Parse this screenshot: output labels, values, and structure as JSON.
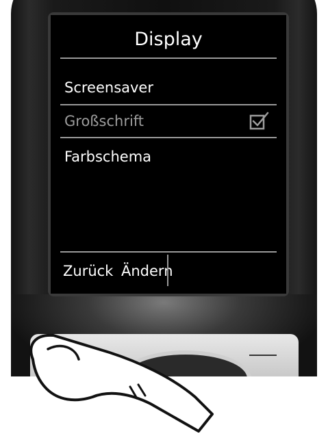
{
  "screen": {
    "title": "Display",
    "menu_items": [
      {
        "label": "Screensaver",
        "state": "normal"
      },
      {
        "label": "Großschrift",
        "state": "inactive",
        "checked": true
      },
      {
        "label": "Farbschema",
        "state": "normal"
      }
    ]
  },
  "softkeys": {
    "left_label": "Zurück",
    "right_label": "Ändern"
  },
  "colors": {
    "screen_bg": "#000000",
    "text": "#ffffff",
    "muted_text": "#9d9d9d",
    "divider": "#9a9a9a"
  },
  "icons": {
    "checkbox": "checked-checkbox-icon",
    "finger": "finger-pointer-icon"
  }
}
